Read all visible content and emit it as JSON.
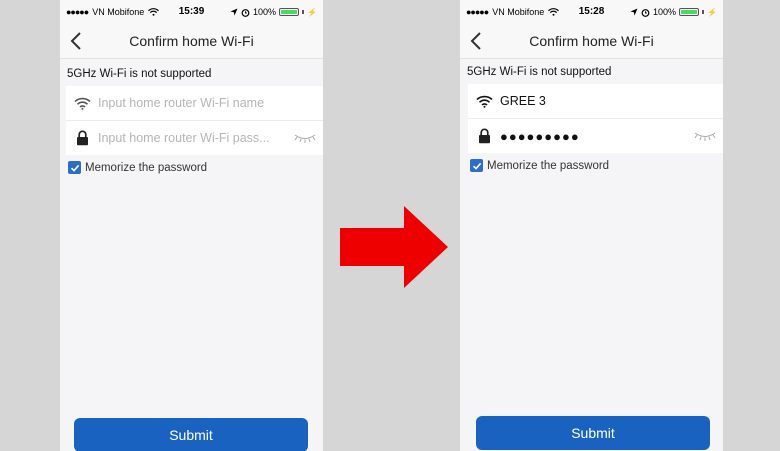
{
  "left_screen": {
    "status_bar": {
      "carrier": "VN Mobifone",
      "time": "15:39",
      "battery": "100%",
      "battery_level": 1.0
    },
    "nav": {
      "title": "Confirm home Wi-Fi"
    },
    "warning": "5GHz Wi-Fi is not supported",
    "wifi_name": {
      "value": "",
      "placeholder": "Input home router Wi-Fi name"
    },
    "wifi_password": {
      "value": "",
      "placeholder": "Input home router Wi-Fi pass..."
    },
    "memorize": {
      "label": "Memorize the password",
      "checked": true
    },
    "submit_label": "Submit"
  },
  "right_screen": {
    "status_bar": {
      "carrier": "VN Mobifone",
      "time": "15:28",
      "battery": "100%",
      "battery_level": 1.0
    },
    "nav": {
      "title": "Confirm home Wi-Fi"
    },
    "warning": "5GHz Wi-Fi is not supported",
    "wifi_name": {
      "value": "GREE 3"
    },
    "wifi_password": {
      "masked_value": "●●●●●●●●●"
    },
    "memorize": {
      "label": "Memorize the password",
      "checked": true
    },
    "submit_label": "Submit"
  },
  "colors": {
    "accent": "#1a62c0",
    "checkbox": "#2c6fc7",
    "arrow": "#ee0000",
    "battery": "#4cd964"
  },
  "icons": [
    "signal-dots-icon",
    "wifi-icon",
    "location-arrow-icon",
    "alarm-icon",
    "battery-icon",
    "back-chevron-icon",
    "lock-icon",
    "closed-eye-icon",
    "checkmark-icon",
    "right-arrow-icon"
  ]
}
